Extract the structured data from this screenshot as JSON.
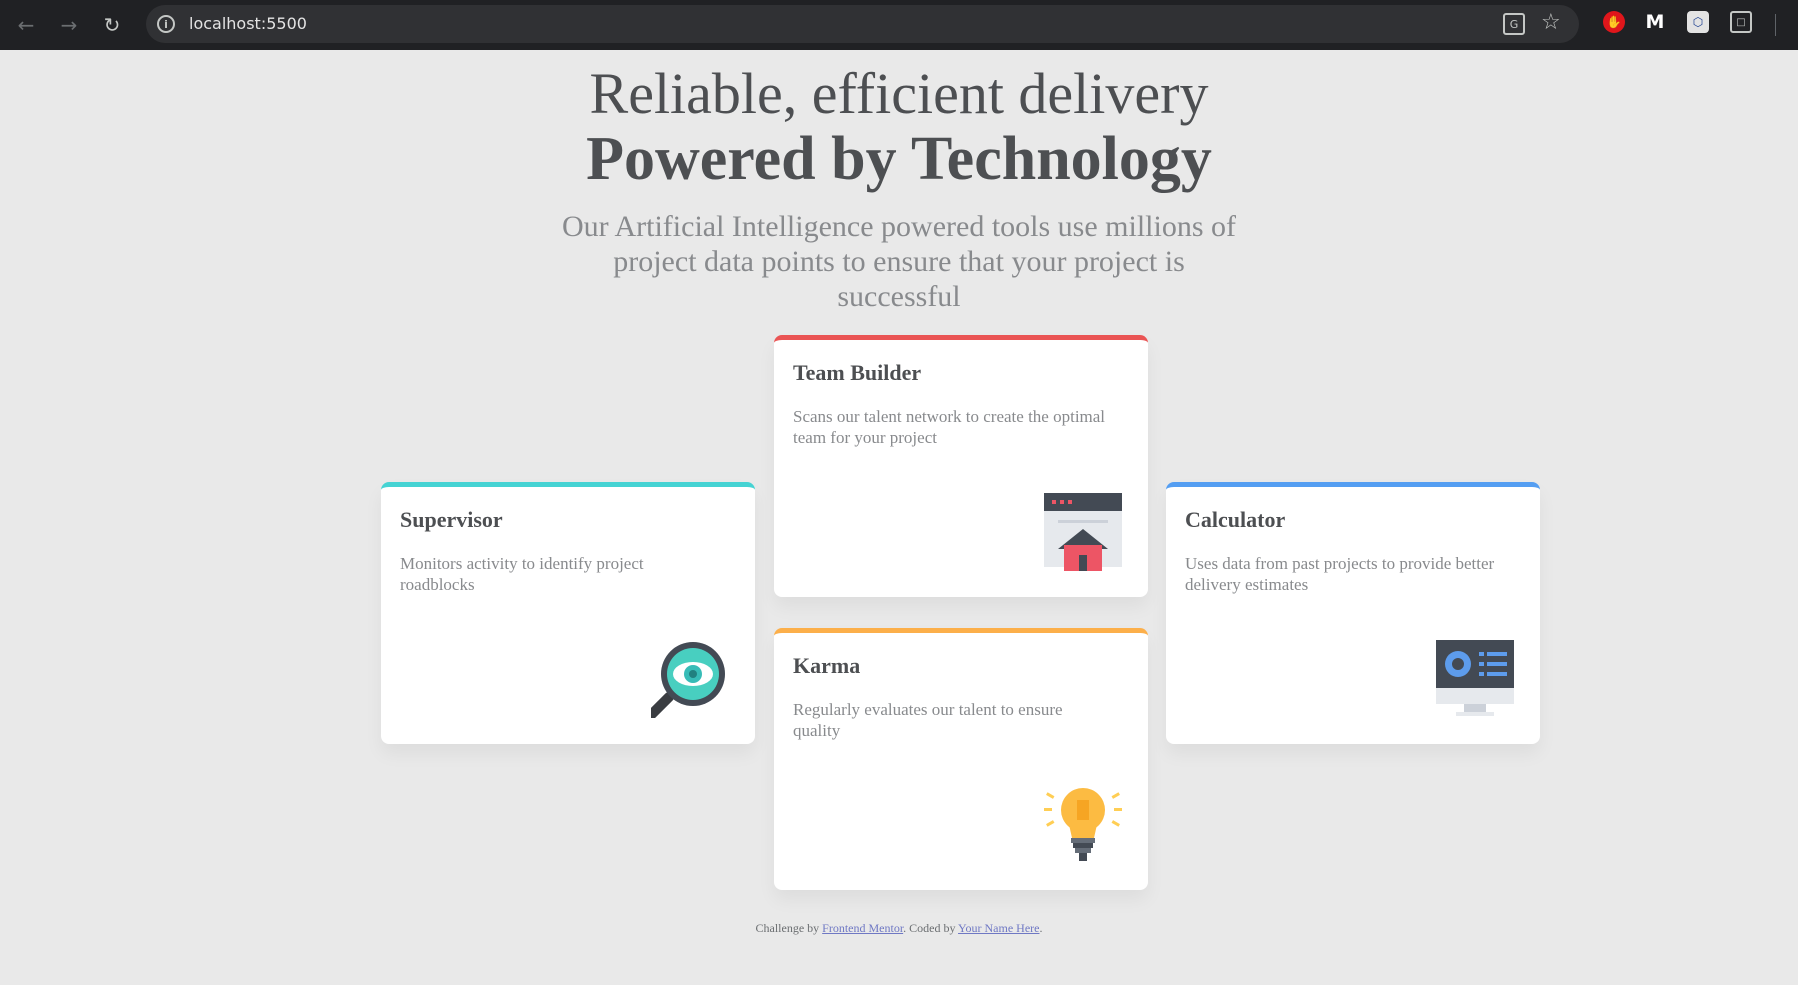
{
  "browser": {
    "url": "localhost:5500",
    "info_icon": "i",
    "translate_icon": "G",
    "ext_icons": [
      "shield-hand-icon",
      "malwarebytes-icon",
      "hex-extension-icon",
      "puzzle-icon"
    ]
  },
  "header": {
    "headline_light": "Reliable, efficient delivery",
    "headline_bold": "Powered by Technology",
    "lede": "Our Artificial Intelligence powered tools use millions of project data points to ensure that your project is successful"
  },
  "cards": [
    {
      "title": "Supervisor",
      "description": "Monitors activity to identify project roadblocks",
      "accent": "#45d3d3",
      "icon": "magnifier-eye-icon"
    },
    {
      "title": "Team Builder",
      "description": "Scans our talent network to create the optimal team for your project",
      "accent": "#ea5454",
      "icon": "browser-house-icon"
    },
    {
      "title": "Karma",
      "description": "Regularly evaluates our talent to ensure quality",
      "accent": "#fcaf4a",
      "icon": "lightbulb-icon"
    },
    {
      "title": "Calculator",
      "description": "Uses data from past projects to provide better delivery estimates",
      "accent": "#549ef2",
      "icon": "monitor-chart-icon"
    }
  ],
  "attribution": {
    "challenge_prefix": "Challenge by ",
    "challenge_link": "Frontend Mentor",
    "coded_prefix": ". Coded by ",
    "author_link": "Your Name Here",
    "suffix": "."
  },
  "colors": {
    "page_background": "#e9e9e9",
    "heading_text": "#4d4f52",
    "body_text": "#888a8d",
    "cyan": "#45d3d3",
    "red": "#ea5454",
    "orange": "#fcaf4a",
    "blue": "#549ef2"
  }
}
